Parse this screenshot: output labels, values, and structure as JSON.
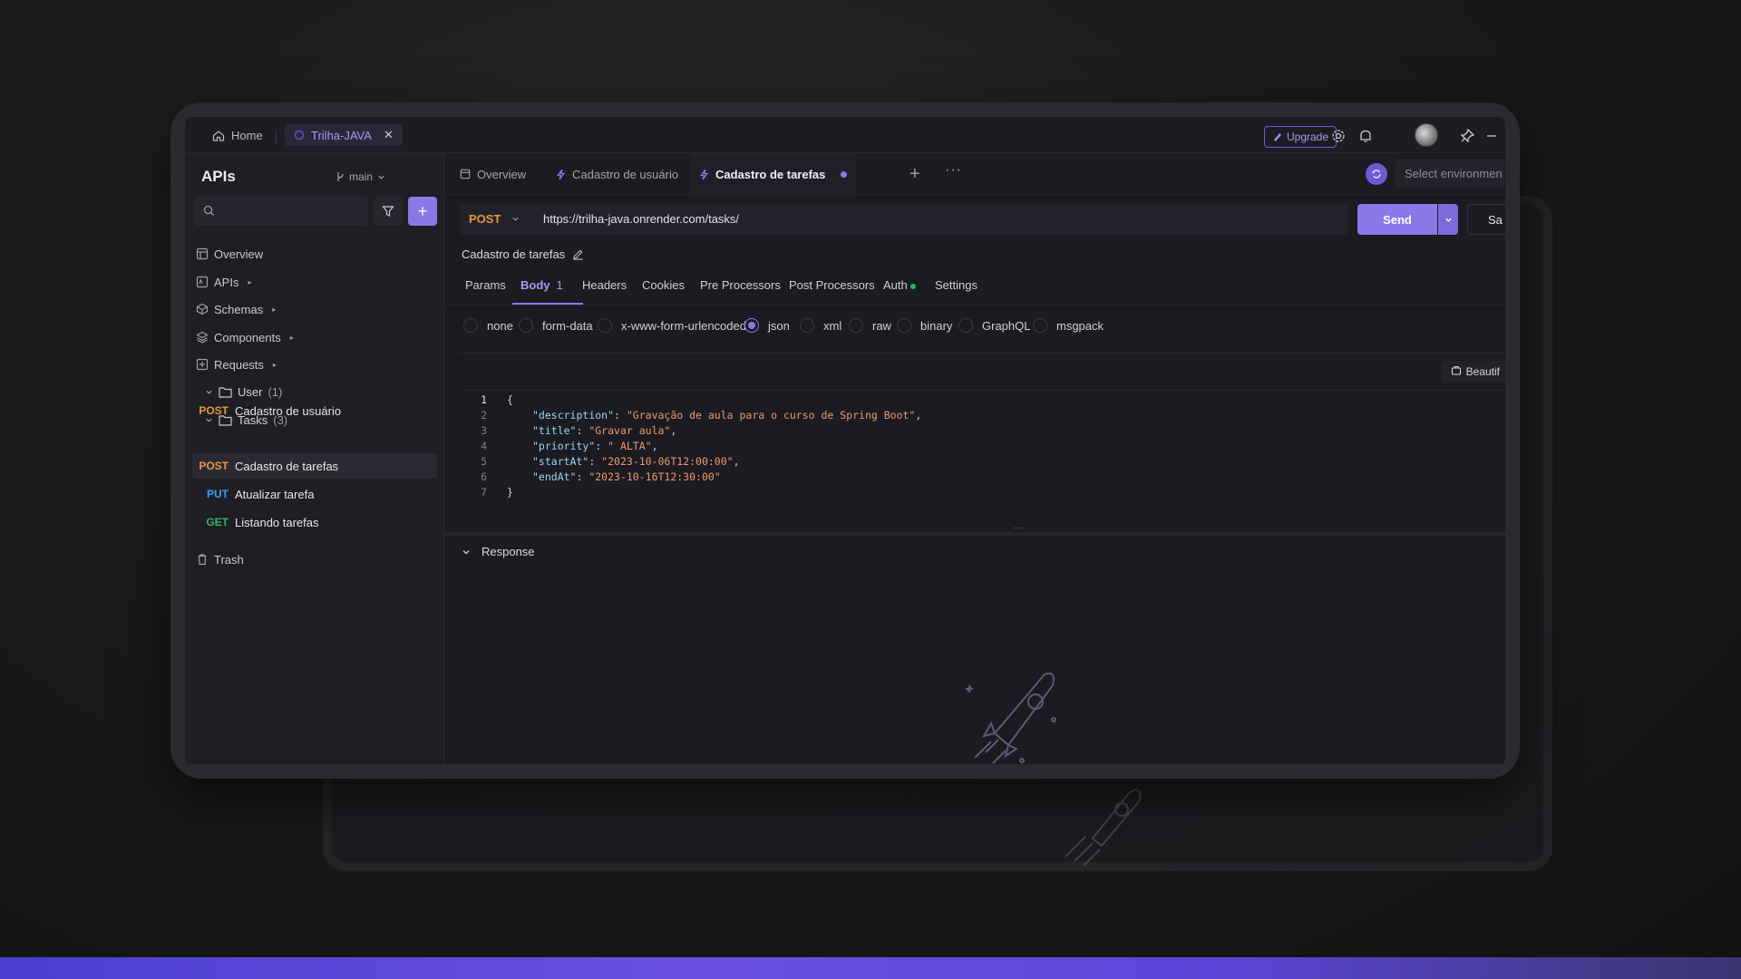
{
  "colors": {
    "accent": "#8a78e6",
    "post": "#e7953d",
    "put": "#3f9cf0",
    "get": "#2fb46a",
    "background": "#1b1b21"
  },
  "topbar": {
    "home_label": "Home",
    "project_tab": "Trilha-JAVA",
    "upgrade_label": "Upgrade",
    "icons": [
      "home-icon",
      "close-icon",
      "settings-icon",
      "bell-icon",
      "pin-icon",
      "minimize-icon"
    ]
  },
  "sidebar": {
    "title": "APIs",
    "branch": "main",
    "nav": {
      "overview": "Overview",
      "apis": "APIs",
      "schemas": "Schemas",
      "components": "Components",
      "requests": "Requests",
      "trash": "Trash"
    },
    "folders": [
      {
        "name": "User",
        "count": "(1)"
      },
      {
        "name": "Tasks",
        "count": "(3)"
      }
    ],
    "requests": [
      {
        "method": "POST",
        "name": "Cadastro de usuário"
      },
      {
        "method": "POST",
        "name": "Cadastro de tarefas"
      },
      {
        "method": "PUT",
        "name": "Atualizar tarefa"
      },
      {
        "method": "GET",
        "name": "Listando tarefas"
      }
    ]
  },
  "tabs": {
    "overview": "Overview",
    "tab1": "Cadastro de usuário",
    "tab2": "Cadastro de tarefas",
    "plus": "+",
    "more": "···",
    "env_placeholder": "Select environmen"
  },
  "request": {
    "method": "POST",
    "url": "https://trilha-java.onrender.com/tasks/",
    "send_label": "Send",
    "save_label": "Sa",
    "name": "Cadastro de tarefas"
  },
  "subtabs": {
    "params": "Params",
    "body": "Body",
    "body_count": "1",
    "headers": "Headers",
    "cookies": "Cookies",
    "pre": "Pre Processors",
    "post": "Post Processors",
    "auth": "Auth",
    "settings": "Settings"
  },
  "body_types": {
    "none": "none",
    "form_data": "form-data",
    "urlencoded": "x-www-form-urlencoded",
    "json": "json",
    "xml": "xml",
    "raw": "raw",
    "binary": "binary",
    "graphql": "GraphQL",
    "msgpack": "msgpack",
    "selected": "json"
  },
  "editor": {
    "beautify_label": "Beautif",
    "lines": [
      {
        "n": "1",
        "open": "{"
      },
      {
        "n": "2",
        "key": "\"description\"",
        "val": "\"Gravação de aula para o curso de Spring Boot\"",
        "end": ","
      },
      {
        "n": "3",
        "key": "\"title\"",
        "val": "\"Gravar aula\"",
        "end": ","
      },
      {
        "n": "4",
        "key": "\"priority\"",
        "val": "\" ALTA\"",
        "end": ","
      },
      {
        "n": "5",
        "key": "\"startAt\"",
        "val": "\"2023-10-06T12:00:00\"",
        "end": ","
      },
      {
        "n": "6",
        "key": "\"endAt\"",
        "val": "\"2023-10-16T12:30:00\"",
        "end": ""
      },
      {
        "n": "7",
        "open": "}"
      }
    ]
  },
  "response": {
    "label": "Response"
  }
}
